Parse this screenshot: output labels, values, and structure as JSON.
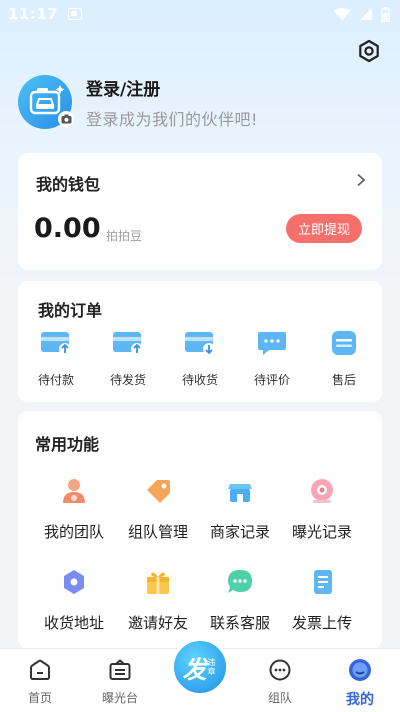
{
  "status_bar": {
    "time": "11:17"
  },
  "profile": {
    "title": "登录/注册",
    "subtitle": "登录成为我们的伙伴吧!"
  },
  "wallet": {
    "title": "我的钱包",
    "amount": "0.00",
    "unit": "拍拍豆",
    "withdraw_label": "立即提现"
  },
  "orders": {
    "title": "我的订单",
    "items": [
      {
        "label": "待付款",
        "icon": "card-upload-icon"
      },
      {
        "label": "待发货",
        "icon": "card-upload-icon"
      },
      {
        "label": "待收货",
        "icon": "card-download-icon"
      },
      {
        "label": "待评价",
        "icon": "chat-bubble-icon"
      },
      {
        "label": "售后",
        "icon": "aftersale-icon"
      }
    ]
  },
  "functions": {
    "title": "常用功能",
    "items": [
      {
        "label": "我的团队",
        "icon": "team-icon"
      },
      {
        "label": "组队管理",
        "icon": "tag-icon"
      },
      {
        "label": "商家记录",
        "icon": "store-icon"
      },
      {
        "label": "曝光记录",
        "icon": "exposure-icon"
      },
      {
        "label": "收货地址",
        "icon": "location-icon"
      },
      {
        "label": "邀请好友",
        "icon": "gift-icon"
      },
      {
        "label": "联系客服",
        "icon": "service-chat-icon"
      },
      {
        "label": "发票上传",
        "icon": "invoice-icon"
      }
    ]
  },
  "tabbar": {
    "items": [
      {
        "label": "首页",
        "icon": "home-icon"
      },
      {
        "label": "曝光台",
        "icon": "exposure-board-icon"
      },
      {
        "label": "组队",
        "icon": "team-chat-icon"
      },
      {
        "label": "我的",
        "icon": "profile-icon",
        "active": true
      }
    ],
    "publish": {
      "main": "发",
      "sub": "违章"
    }
  },
  "colors": {
    "accent": "#3566d8",
    "withdraw": "#f6706b",
    "avatar": "#2a8ee8"
  }
}
